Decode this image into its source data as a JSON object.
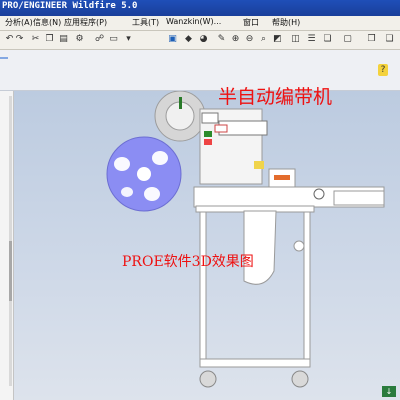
{
  "window": {
    "title": "PRO/ENGINEER Wildfire 5.0"
  },
  "menubar": {
    "items": [
      "分析(A)",
      "信息(N)",
      "应用程序(P)",
      "工具(T)",
      "Wanzkin(W)...",
      "窗口",
      "帮助(H)"
    ]
  },
  "toolbar": {
    "icons": [
      "undo-icon",
      "redo-icon",
      "cut-icon",
      "copy-icon",
      "paste-icon",
      "regenerate-icon",
      "find-icon",
      "select-box-icon",
      "view-icon",
      "zoom-in-icon",
      "zoom-out-icon",
      "refit-icon",
      "spin-icon",
      "shading-icon",
      "saved-view-icon",
      "layers-icon",
      "window-icon"
    ]
  },
  "viewport": {
    "model_name": "半自动编带机",
    "caption": "PROE软件3D效果图"
  },
  "colors": {
    "title_bar": "#1f4fb8",
    "overlay_text": "#e11111",
    "reel": "#8b8df3",
    "machine_frame": "#ffffff",
    "background_top": "#bccbe0"
  }
}
